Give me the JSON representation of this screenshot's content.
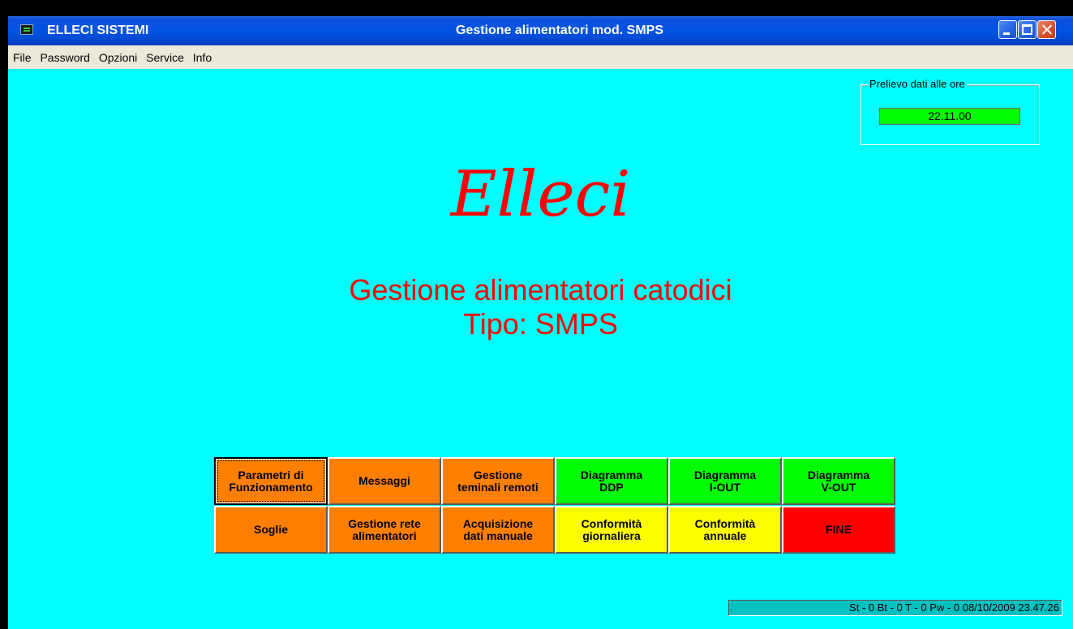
{
  "titlebar": {
    "app_name": "ELLECI SISTEMI",
    "window_title": "Gestione alimentatori mod. SMPS"
  },
  "menu": [
    "File",
    "Password",
    "Opzioni",
    "Service",
    "Info"
  ],
  "data_fetch": {
    "label": "Prelievo dati alle ore",
    "time": "22.11.00"
  },
  "main": {
    "logo": "Elleci",
    "subtitle_line1": "Gestione alimentatori catodici",
    "subtitle_line2": "Tipo: SMPS"
  },
  "buttons": {
    "row1": [
      {
        "l1": "Parametri di",
        "l2": "Funzionamento",
        "color": "#ff8000"
      },
      {
        "l1": "Messaggi",
        "l2": "",
        "color": "#ff8000"
      },
      {
        "l1": "Gestione",
        "l2": "teminali remoti",
        "color": "#ff8000"
      },
      {
        "l1": "Diagramma",
        "l2": "DDP",
        "color": "#00ff00"
      },
      {
        "l1": "Diagramma",
        "l2": "I-OUT",
        "color": "#00ff00"
      },
      {
        "l1": "Diagramma",
        "l2": "V-OUT",
        "color": "#00ff00"
      }
    ],
    "row2": [
      {
        "l1": "Soglie",
        "l2": "",
        "color": "#ff8000"
      },
      {
        "l1": "Gestione rete",
        "l2": "alimentatori",
        "color": "#ff8000"
      },
      {
        "l1": "Acquisizione",
        "l2": "dati manuale",
        "color": "#ff8000"
      },
      {
        "l1": "Conformità",
        "l2": "giornaliera",
        "color": "#ffff00"
      },
      {
        "l1": "Conformità",
        "l2": "annuale",
        "color": "#ffff00"
      },
      {
        "l1": "FINE",
        "l2": "",
        "color": "#ff0000"
      }
    ]
  },
  "status_bar": "St - 0  Bt - 0  T - 0  Pw - 0  08/10/2009 23.47.26"
}
